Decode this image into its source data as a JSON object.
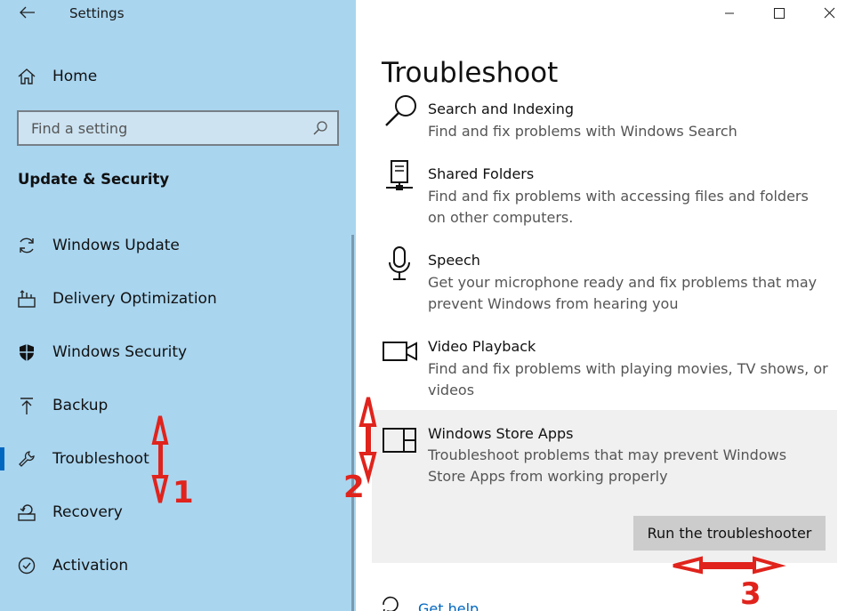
{
  "window": {
    "app_title": "Settings",
    "icons": {
      "back": "back-arrow-icon",
      "minimize": "minimize-icon",
      "maximize": "maximize-icon",
      "close": "close-icon"
    }
  },
  "sidebar": {
    "home": {
      "label": "Home",
      "icon": "home-icon"
    },
    "search": {
      "placeholder": "Find a setting",
      "icon": "search-icon"
    },
    "section_title": "Update & Security",
    "items": [
      {
        "label": "Windows Update",
        "icon": "sync-icon",
        "active": false
      },
      {
        "label": "Delivery Optimization",
        "icon": "delivery-optimization-icon",
        "active": false
      },
      {
        "label": "Windows Security",
        "icon": "shield-icon",
        "active": false
      },
      {
        "label": "Backup",
        "icon": "backup-arrow-icon",
        "active": false
      },
      {
        "label": "Troubleshoot",
        "icon": "wrench-icon",
        "active": true
      },
      {
        "label": "Recovery",
        "icon": "recovery-icon",
        "active": false
      },
      {
        "label": "Activation",
        "icon": "check-circle-icon",
        "active": false
      }
    ]
  },
  "main": {
    "page_title": "Troubleshoot",
    "troubleshooters": [
      {
        "name": "Search and Indexing",
        "description": "Find and fix problems with Windows Search",
        "icon": "magnifier-icon"
      },
      {
        "name": "Shared Folders",
        "description": "Find and fix problems with accessing files and folders on other computers.",
        "icon": "network-drive-icon"
      },
      {
        "name": "Speech",
        "description": "Get your microphone ready and fix problems that may prevent Windows from hearing you",
        "icon": "microphone-icon"
      },
      {
        "name": "Video Playback",
        "description": "Find and fix problems with playing movies, TV shows, or videos",
        "icon": "video-camera-icon"
      },
      {
        "name": "Windows Store Apps",
        "description": "Troubleshoot problems that may prevent Windows Store Apps from working properly",
        "icon": "store-apps-icon",
        "selected": true
      }
    ],
    "run_button": "Run the troubleshooter",
    "help": {
      "label": "Get help",
      "icon": "help-chat-icon"
    }
  },
  "annotations": {
    "numbers": [
      "1",
      "2",
      "3"
    ],
    "color": "#e0231c"
  },
  "colors": {
    "sidebar_bg": "#a9d5ef",
    "accent": "#0067c0",
    "selected_bg": "#f0f0f0",
    "button_bg": "#cccccc"
  }
}
